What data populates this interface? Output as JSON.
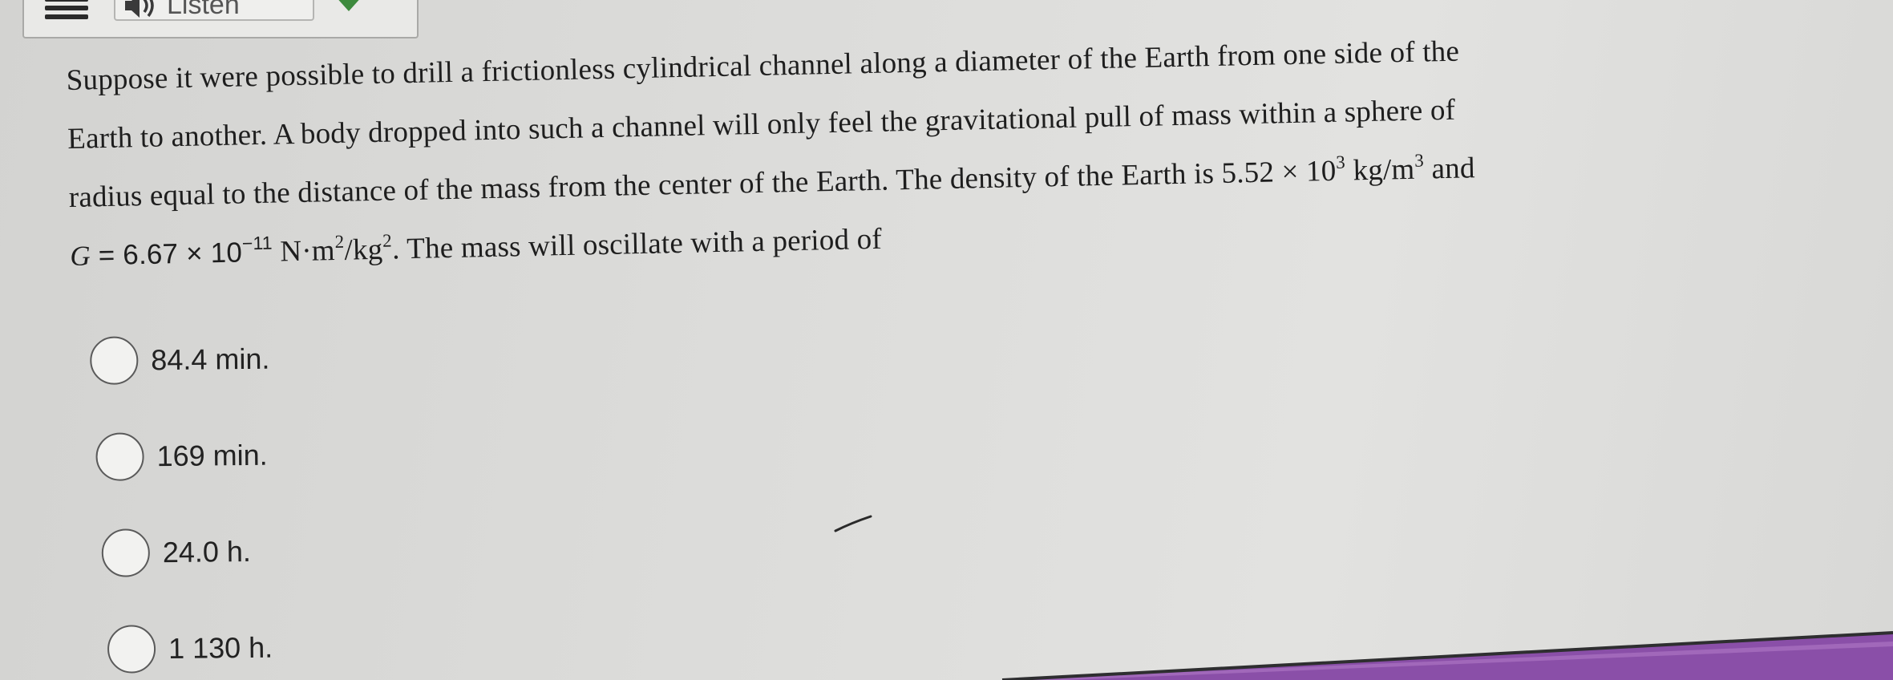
{
  "toolbar": {
    "menu_icon": "hamburger-menu-icon",
    "listen_icon": "speaker-icon",
    "listen_label": "Listen",
    "play_icon": "play-arrow-icon"
  },
  "question": {
    "line1": "Suppose it were possible to drill a frictionless cylindrical channel along a diameter of the Earth from one side of the",
    "line2": "Earth to another. A body dropped into such a channel will only feel the gravitational pull of mass within a sphere of",
    "line3_pre": "radius equal to the distance of the mass from the center of the Earth. The density of the Earth is 5.52 × 10",
    "line3_exp1": "3",
    "line3_unit": " kg/m",
    "line3_exp2": "3",
    "line3_post": " and",
    "line4_g": "G",
    "line4_eq": " = 6.67 × 10",
    "line4_exp1": "−11",
    "line4_unit1": " N·m",
    "line4_exp2": "2",
    "line4_unit2": "/kg",
    "line4_exp3": "2",
    "line4_post": ". The mass will oscillate with a period of"
  },
  "options": [
    {
      "label": "84.4 min."
    },
    {
      "label": "169 min."
    },
    {
      "label": "24.0 h."
    },
    {
      "label": "1 130 h."
    }
  ],
  "colors": {
    "background": "#dcdcda",
    "text": "#1e1e1e",
    "radio_border": "#5a5a5a",
    "edge_purple": "#8a4fa8"
  }
}
